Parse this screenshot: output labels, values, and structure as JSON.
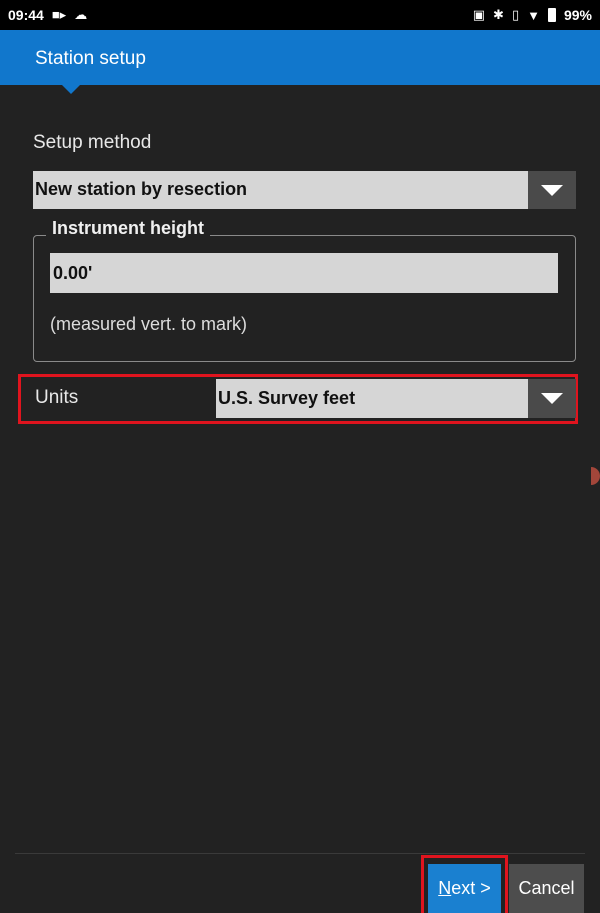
{
  "status_bar": {
    "time": "09:44",
    "icons_left": [
      "video-icon",
      "cloud-icon"
    ],
    "icons_right": [
      "cast-icon",
      "bluetooth-icon",
      "vibrate-icon",
      "wifi-icon",
      "battery-icon"
    ],
    "battery_percent": "99%"
  },
  "app_bar": {
    "title": "Station setup",
    "accent_color": "#1177cc"
  },
  "form": {
    "setup_method_label": "Setup method",
    "setup_method_value": "New station by resection",
    "instrument_height_title": "Instrument height",
    "instrument_height_value": "0.00'",
    "instrument_height_hint": "(measured vert. to mark)",
    "units_label": "Units",
    "units_value": "U.S. Survey feet"
  },
  "footer": {
    "next_mnemonic": "N",
    "next_rest": "ext >",
    "cancel_label": "Cancel"
  },
  "highlight_color": "#e0141e"
}
